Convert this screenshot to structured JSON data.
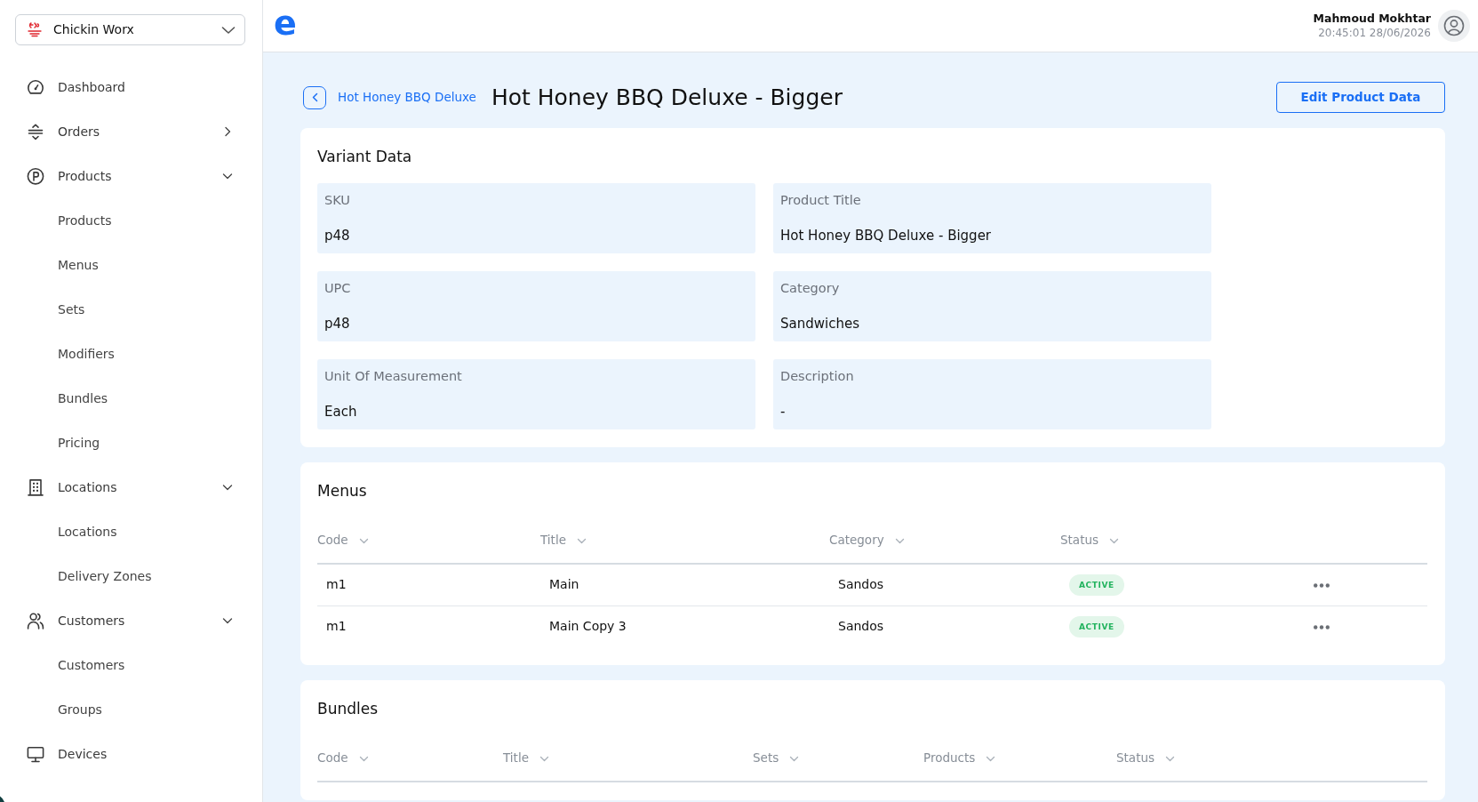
{
  "sidebar": {
    "brand_selector": {
      "label": "Chickin Worx"
    },
    "items": [
      {
        "kind": "link",
        "label": "Dashboard"
      },
      {
        "kind": "group",
        "label": "Orders",
        "expanded": false
      },
      {
        "kind": "group",
        "label": "Products",
        "expanded": true,
        "children": [
          {
            "label": "Products"
          },
          {
            "label": "Menus"
          },
          {
            "label": "Sets"
          },
          {
            "label": "Modifiers"
          },
          {
            "label": "Bundles"
          },
          {
            "label": "Pricing"
          }
        ]
      },
      {
        "kind": "group",
        "label": "Locations",
        "expanded": true,
        "children": [
          {
            "label": "Locations"
          },
          {
            "label": "Delivery Zones"
          }
        ]
      },
      {
        "kind": "group",
        "label": "Customers",
        "expanded": true,
        "children": [
          {
            "label": "Customers"
          },
          {
            "label": "Groups"
          }
        ]
      },
      {
        "kind": "link",
        "label": "Devices"
      }
    ]
  },
  "header": {
    "logo_text": "e",
    "user": {
      "name": "Mahmoud Mokhtar",
      "timestamp": "20:45:01 28/06/2026"
    }
  },
  "page": {
    "back_link": "Hot Honey BBQ Deluxe",
    "title": "Hot Honey BBQ Deluxe - Bigger",
    "actions": [
      "Edit Product Data"
    ]
  },
  "variant_data": {
    "title": "Variant Data",
    "fields": [
      {
        "label": "SKU",
        "value": "p48"
      },
      {
        "label": "Product Title",
        "value": "Hot Honey BBQ Deluxe - Bigger"
      },
      {
        "label": "UPC",
        "value": "p48"
      },
      {
        "label": "Category",
        "value": "Sandwiches"
      },
      {
        "label": "Unit Of Measurement",
        "value": "Each"
      },
      {
        "label": "Description",
        "value": "-"
      }
    ]
  },
  "menus": {
    "title": "Menus",
    "columns": [
      "Code",
      "Title",
      "Category",
      "Status"
    ],
    "rows": [
      {
        "code": "m1",
        "title": "Main",
        "category": "Sandos",
        "status": "ACTIVE"
      },
      {
        "code": "m1",
        "title": "Main Copy 3",
        "category": "Sandos",
        "status": "ACTIVE"
      }
    ]
  },
  "bundles": {
    "title": "Bundles",
    "columns": [
      "Code",
      "Title",
      "Sets",
      "Products",
      "Status"
    ]
  }
}
